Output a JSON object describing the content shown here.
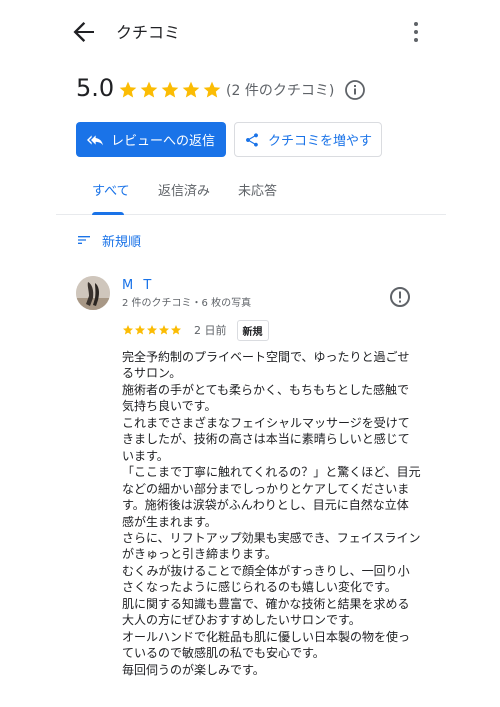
{
  "appbar": {
    "title": "クチコミ"
  },
  "summary": {
    "score": "5.0",
    "stars": 5,
    "review_count": "(2 件のクチコミ)"
  },
  "actions": {
    "reply_label": "レビューへの返信",
    "get_more_label": "クチコミを増やす"
  },
  "tabs": [
    {
      "label": "すべて",
      "active": true
    },
    {
      "label": "返信済み",
      "active": false
    },
    {
      "label": "未応答",
      "active": false
    }
  ],
  "sort": {
    "label": "新規順"
  },
  "review": {
    "name": "M T",
    "meta": "2 件のクチコミ・6 枚の写真",
    "stars": 5,
    "date": "2 日前",
    "badge": "新規",
    "lines": [
      "完全予約制のプライベート空間で、ゆったりと過ごせ",
      "るサロン。",
      "施術者の手がとても柔らかく、もちもちとした感触で",
      "気持ち良いです。",
      "これまでさまざまなフェイシャルマッサージを受けて",
      "きましたが、技術の高さは本当に素晴らしいと感じて",
      "います。",
      "「ここまで丁寧に触れてくれるの？」と驚くほど、目元",
      "などの細かい部分までしっかりとケアしてくださいま",
      "す。施術後は涙袋がふんわりとし、目元に自然な立体",
      "感が生まれます。",
      "さらに、リフトアップ効果も実感でき、フェイスライン",
      "がきゅっと引き締まります。",
      "むくみが抜けることで顔全体がすっきりし、一回り小",
      "さくなったように感じられるのも嬉しい変化です。",
      "肌に関する知識も豊富で、確かな技術と結果を求める",
      "大人の方にぜひおすすめしたいサロンです。",
      "オールハンドで化粧品も肌に優しい日本製の物を使っ",
      "ているので敏感肌の私でも安心です。",
      "毎回伺うのが楽しみです。"
    ]
  },
  "colors": {
    "accent": "#1a73e8",
    "star": "#fbbc04",
    "text": "#202124",
    "muted": "#5f6368"
  },
  "icons": [
    "back-arrow-icon",
    "more-vert-icon",
    "star-icon",
    "info-icon",
    "reply-icon",
    "share-icon",
    "sort-icon",
    "flag-icon"
  ]
}
